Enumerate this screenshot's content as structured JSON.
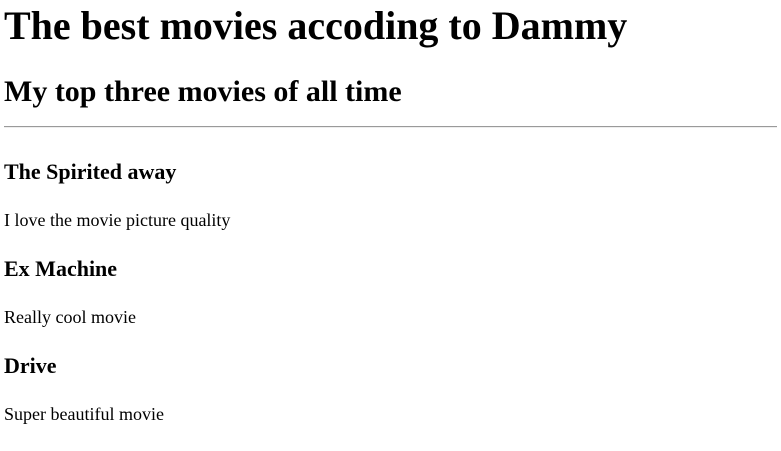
{
  "page": {
    "title": "The best movies accoding to Dammy",
    "subtitle": "My top three movies of all time"
  },
  "movies": [
    {
      "title": "The Spirited away",
      "description": "I love the movie picture quality"
    },
    {
      "title": "Ex Machine",
      "description": "Really cool movie"
    },
    {
      "title": "Drive",
      "description": "Super beautiful movie"
    }
  ]
}
